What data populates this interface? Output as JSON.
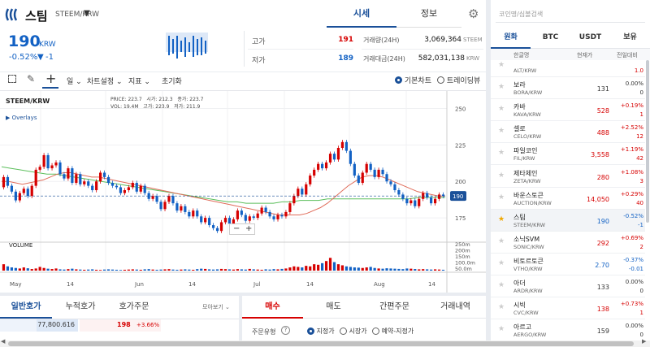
{
  "coin": {
    "name": "스팀",
    "pair": "STEEM/KRW",
    "price": "190",
    "unit": "KRW",
    "change_pct": "-0.52%",
    "change_arrow": "▼",
    "change_amt": "-1"
  },
  "tabs": {
    "quote": "시세",
    "info": "정보"
  },
  "stats": {
    "high_label": "고가",
    "high": "191",
    "low_label": "저가",
    "low": "189",
    "vol_label": "거래량(24H)",
    "vol": "3,069,364",
    "vol_unit": "STEEM",
    "amount_label": "거래대금(24H)",
    "amount": "582,031,138",
    "amount_unit": "KRW"
  },
  "toolbar": {
    "interval": "일",
    "chart_settings": "차트설정",
    "indicators": "지표",
    "reset": "초기화",
    "basic_chart": "기본차트",
    "trading_view": "트레이딩뷰"
  },
  "legend": {
    "pair": "STEEM/KRW",
    "overlays": "Overlays",
    "price_label": "PRICE:",
    "price": "223.7",
    "open_label": "시가:",
    "open": "212.3",
    "close_label": "종가:",
    "close": "223.7",
    "vol_label": "VOL:",
    "vol": "19.4M",
    "high_label": "고가:",
    "high": "223.9",
    "low_label": "저가:",
    "low": "211.9",
    "volume_title": "VOLUME"
  },
  "chart_data": {
    "type": "candlestick",
    "ylim": [
      160,
      262
    ],
    "y_ticks": [
      "250",
      "225",
      "200",
      "175"
    ],
    "volume_ticks": [
      "250m",
      "200m",
      "150m",
      "100.0m",
      "50.0m"
    ],
    "x_ticks": [
      "May",
      "14",
      "Jun",
      "14",
      "Jul",
      "14",
      "Aug",
      "14"
    ],
    "current_price": "190",
    "candles": [
      [
        196,
        203
      ],
      [
        203,
        197
      ],
      [
        197,
        193
      ],
      [
        193,
        187
      ],
      [
        187,
        192
      ],
      [
        192,
        195
      ],
      [
        195,
        190
      ],
      [
        190,
        197
      ],
      [
        197,
        208
      ],
      [
        208,
        210
      ],
      [
        210,
        218
      ],
      [
        218,
        209
      ],
      [
        209,
        211
      ],
      [
        211,
        213
      ],
      [
        213,
        205
      ],
      [
        205,
        202
      ],
      [
        202,
        209
      ],
      [
        209,
        199
      ],
      [
        199,
        205
      ],
      [
        205,
        198
      ],
      [
        198,
        200
      ],
      [
        200,
        197
      ],
      [
        197,
        194
      ],
      [
        194,
        200
      ],
      [
        200,
        206
      ],
      [
        206,
        203
      ],
      [
        203,
        199
      ],
      [
        199,
        197
      ],
      [
        197,
        196
      ],
      [
        196,
        192
      ],
      [
        192,
        194
      ],
      [
        194,
        196
      ],
      [
        196,
        199
      ],
      [
        199,
        193
      ],
      [
        193,
        197
      ],
      [
        197,
        192
      ],
      [
        192,
        188
      ],
      [
        188,
        190
      ],
      [
        190,
        186
      ],
      [
        186,
        181
      ],
      [
        181,
        186
      ],
      [
        186,
        190
      ],
      [
        190,
        185
      ],
      [
        185,
        180
      ],
      [
        180,
        183
      ],
      [
        183,
        179
      ],
      [
        179,
        176
      ],
      [
        176,
        180
      ],
      [
        180,
        176
      ],
      [
        176,
        172
      ],
      [
        172,
        175
      ],
      [
        175,
        170
      ],
      [
        170,
        168
      ],
      [
        168,
        166
      ],
      [
        166,
        172
      ],
      [
        172,
        175
      ],
      [
        175,
        171
      ],
      [
        171,
        174
      ],
      [
        174,
        180
      ],
      [
        180,
        177
      ],
      [
        177,
        173
      ],
      [
        173,
        176
      ],
      [
        176,
        175
      ],
      [
        175,
        178
      ],
      [
        178,
        182
      ],
      [
        182,
        179
      ],
      [
        179,
        176
      ],
      [
        176,
        174
      ],
      [
        174,
        177
      ],
      [
        177,
        176
      ],
      [
        176,
        179
      ],
      [
        179,
        185
      ],
      [
        185,
        190
      ],
      [
        190,
        195
      ],
      [
        195,
        191
      ],
      [
        191,
        198
      ],
      [
        198,
        204
      ],
      [
        204,
        208
      ],
      [
        208,
        212
      ],
      [
        212,
        209
      ],
      [
        209,
        213
      ],
      [
        213,
        219
      ],
      [
        219,
        215
      ],
      [
        215,
        223
      ],
      [
        223,
        227
      ],
      [
        227,
        221
      ],
      [
        221,
        212
      ],
      [
        212,
        204
      ],
      [
        204,
        199
      ],
      [
        199,
        206
      ],
      [
        206,
        212
      ],
      [
        212,
        208
      ],
      [
        208,
        203
      ],
      [
        203,
        208
      ],
      [
        208,
        205
      ],
      [
        205,
        200
      ],
      [
        200,
        198
      ],
      [
        198,
        194
      ],
      [
        194,
        191
      ],
      [
        191,
        188
      ],
      [
        188,
        185
      ],
      [
        185,
        187
      ],
      [
        187,
        183
      ],
      [
        183,
        188
      ],
      [
        188,
        192
      ],
      [
        192,
        189
      ],
      [
        189,
        185
      ],
      [
        185,
        188
      ],
      [
        188,
        191
      ],
      [
        191,
        190
      ]
    ],
    "ma_short": [
      200,
      200,
      199,
      198,
      199,
      200,
      201,
      203,
      205,
      206,
      206,
      205,
      204,
      203,
      203,
      202,
      201,
      200,
      199,
      198,
      197,
      196,
      195,
      194,
      193,
      192,
      191,
      190,
      189,
      188,
      187,
      186,
      185,
      184,
      183,
      182,
      181,
      180,
      179,
      178,
      177,
      177,
      177,
      177,
      178,
      180,
      182,
      185,
      189,
      193,
      197,
      200,
      203,
      204,
      204,
      203,
      201,
      199,
      197,
      195,
      193,
      192,
      191,
      190,
      190
    ],
    "ma_long": [
      210,
      209,
      208,
      207,
      206,
      205,
      205,
      204,
      203,
      202,
      201,
      200,
      199,
      198,
      197,
      196,
      195,
      194,
      193,
      192,
      191,
      190,
      189,
      188,
      187,
      186,
      186,
      185,
      185,
      185,
      185,
      186,
      186,
      187,
      187,
      187,
      188,
      188,
      188,
      188,
      188,
      188,
      188,
      188,
      188,
      188,
      189,
      189,
      189,
      189
    ],
    "volumes": [
      60,
      40,
      30,
      25,
      20,
      30,
      22,
      15,
      20,
      35,
      25,
      18,
      15,
      20,
      12,
      10,
      14,
      18,
      12,
      10,
      8,
      10,
      12,
      8,
      6,
      10,
      12,
      10,
      8,
      6,
      8,
      10,
      12,
      10,
      8,
      12,
      14,
      10,
      8,
      10,
      12,
      14,
      10,
      8,
      10,
      12,
      10,
      8,
      14,
      18,
      16,
      12,
      10,
      12,
      16,
      14,
      12,
      10,
      14,
      12,
      10,
      16,
      12,
      10,
      8,
      12,
      10,
      14,
      12,
      16,
      20,
      30,
      40,
      35,
      30,
      45,
      40,
      60,
      55,
      70,
      90,
      120,
      80,
      60,
      50,
      40,
      35,
      30,
      28,
      25,
      30,
      35,
      25,
      20,
      18,
      22,
      20,
      18,
      16,
      14,
      20,
      18,
      15,
      12,
      14,
      12,
      10,
      12,
      10,
      8
    ]
  },
  "orderbook": {
    "tabs": [
      "일반호가",
      "누적호가",
      "호가주문"
    ],
    "view": "모아보기",
    "row_qty": "77,800.616",
    "row_price": "198",
    "row_pct": "+3.66%"
  },
  "order": {
    "tabs": [
      "매수",
      "매도",
      "간편주문",
      "거래내역"
    ],
    "type_label": "주문유형",
    "opts": [
      "지정가",
      "시장가",
      "예약-지정가"
    ]
  },
  "market": {
    "search_placeholder": "코인명/심볼검색",
    "tabs": [
      "원화",
      "BTC",
      "USDT",
      "보유"
    ],
    "headers": [
      "한글명",
      "현재가",
      "전일대비"
    ],
    "rows": [
      {
        "name": "",
        "sym": "ALT/KRW",
        "price": "",
        "pct": "",
        "amt": "1.0",
        "cls": "up",
        "star": false
      },
      {
        "name": "보라",
        "sym": "BORA/KRW",
        "price": "131",
        "pct": "0.00%",
        "amt": "0",
        "cls": "",
        "star": false
      },
      {
        "name": "카바",
        "sym": "KAVA/KRW",
        "price": "528",
        "pct": "+0.19%",
        "amt": "1",
        "cls": "up",
        "star": false
      },
      {
        "name": "셀로",
        "sym": "CELO/KRW",
        "price": "488",
        "pct": "+2.52%",
        "amt": "12",
        "cls": "up",
        "star": false
      },
      {
        "name": "파일코인",
        "sym": "FIL/KRW",
        "price": "3,558",
        "pct": "+1.19%",
        "amt": "42",
        "cls": "up",
        "star": false
      },
      {
        "name": "제타체인",
        "sym": "ZETA/KRW",
        "price": "280",
        "pct": "+1.08%",
        "amt": "3",
        "cls": "up",
        "star": false
      },
      {
        "name": "바운스토큰",
        "sym": "AUCTION/KRW",
        "price": "14,050",
        "pct": "+0.29%",
        "amt": "40",
        "cls": "up",
        "star": false
      },
      {
        "name": "스팀",
        "sym": "STEEM/KRW",
        "price": "190",
        "pct": "-0.52%",
        "amt": "-1",
        "cls": "down",
        "star": true
      },
      {
        "name": "소닉SVM",
        "sym": "SONIC/KRW",
        "price": "292",
        "pct": "+0.69%",
        "amt": "2",
        "cls": "up",
        "star": false
      },
      {
        "name": "비토르토큰",
        "sym": "VTHO/KRW",
        "price": "2.70",
        "pct": "-0.37%",
        "amt": "-0.01",
        "cls": "down",
        "star": false
      },
      {
        "name": "아더",
        "sym": "ARDR/KRW",
        "price": "133",
        "pct": "0.00%",
        "amt": "0",
        "cls": "",
        "star": false
      },
      {
        "name": "시빅",
        "sym": "CVC/KRW",
        "price": "138",
        "pct": "+0.73%",
        "amt": "1",
        "cls": "up",
        "star": false
      },
      {
        "name": "아르고",
        "sym": "AERGO/KRW",
        "price": "159",
        "pct": "0.00%",
        "amt": "0",
        "cls": "",
        "star": false
      }
    ]
  }
}
